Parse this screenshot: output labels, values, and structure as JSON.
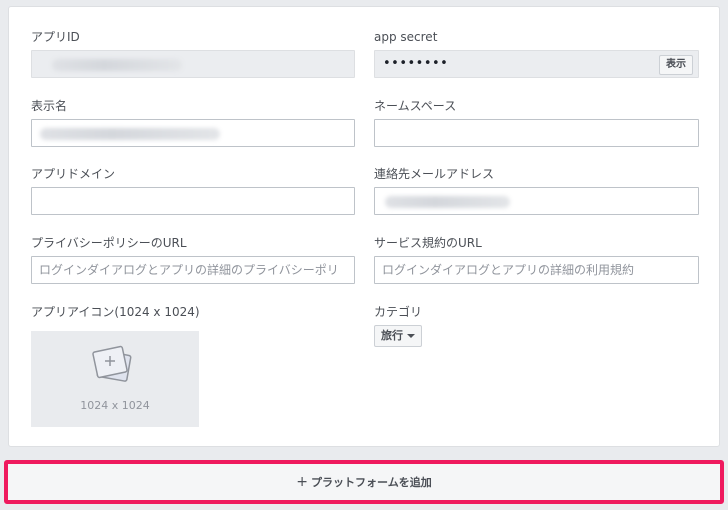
{
  "form": {
    "app_id": {
      "label": "アプリID",
      "value": ""
    },
    "app_secret": {
      "label": "app secret",
      "value": "••••••••",
      "show_label": "表示"
    },
    "display_name": {
      "label": "表示名",
      "value": ""
    },
    "namespace": {
      "label": "ネームスペース",
      "value": ""
    },
    "app_domains": {
      "label": "アプリドメイン",
      "value": ""
    },
    "contact_email": {
      "label": "連絡先メールアドレス",
      "value": ""
    },
    "privacy_url": {
      "label": "プライバシーポリシーのURL",
      "placeholder": "ログインダイアログとアプリの詳細のプライバシーポリ"
    },
    "terms_url": {
      "label": "サービス規約のURL",
      "placeholder": "ログインダイアログとアプリの詳細の利用規約"
    },
    "app_icon": {
      "label": "アプリアイコン(1024 x 1024)",
      "size_text": "1024 x 1024",
      "icon": "image-add-icon"
    },
    "category": {
      "label": "カテゴリ",
      "selected": "旅行",
      "icon": "caret-down-icon"
    }
  },
  "add_platform": {
    "label": "プラットフォームを追加",
    "icon": "plus-icon",
    "highlight_color": "#ef1a5e"
  },
  "colors": {
    "background": "#e9ebee",
    "panel": "#ffffff",
    "border": "#bec3c9",
    "readonly": "#ebedf0"
  }
}
